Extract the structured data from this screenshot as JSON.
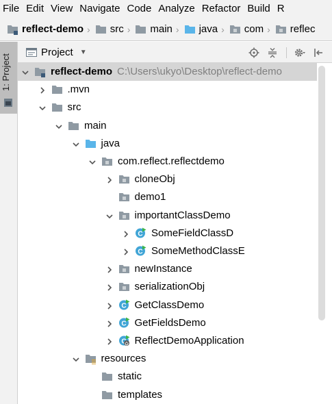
{
  "menu": {
    "items": [
      "File",
      "Edit",
      "View",
      "Navigate",
      "Code",
      "Analyze",
      "Refactor",
      "Build",
      "R"
    ]
  },
  "breadcrumb": {
    "items": [
      {
        "label": "reflect-demo",
        "icon": "module-folder-icon",
        "bold": true
      },
      {
        "label": "src",
        "icon": "folder-icon"
      },
      {
        "label": "main",
        "icon": "folder-icon"
      },
      {
        "label": "java",
        "icon": "source-folder-icon"
      },
      {
        "label": "com",
        "icon": "package-icon"
      },
      {
        "label": "reflec",
        "icon": "package-icon"
      }
    ]
  },
  "tool_window": {
    "tab_label": "1: Project"
  },
  "panel": {
    "title": "Project",
    "header_icons": [
      "locate-icon",
      "collapse-all-icon",
      "settings-gear-icon",
      "hide-panel-icon"
    ]
  },
  "tree": {
    "rows": [
      {
        "label": "reflect-demo",
        "hint": "C:\\Users\\ukyo\\Desktop\\reflect-demo",
        "depth": 0,
        "arrow": "expanded",
        "icon": "module-folder",
        "bold": true,
        "selected": true
      },
      {
        "label": ".mvn",
        "depth": 1,
        "arrow": "collapsed",
        "icon": "folder"
      },
      {
        "label": "src",
        "depth": 1,
        "arrow": "expanded",
        "icon": "folder"
      },
      {
        "label": "main",
        "depth": 2,
        "arrow": "expanded",
        "icon": "folder"
      },
      {
        "label": "java",
        "depth": 3,
        "arrow": "expanded",
        "icon": "source-folder"
      },
      {
        "label": "com.reflect.reflectdemo",
        "depth": 4,
        "arrow": "expanded",
        "icon": "package"
      },
      {
        "label": "cloneObj",
        "depth": 5,
        "arrow": "collapsed",
        "icon": "package"
      },
      {
        "label": "demo1",
        "depth": 5,
        "arrow": "none",
        "icon": "package"
      },
      {
        "label": "importantClassDemo",
        "depth": 5,
        "arrow": "expanded",
        "icon": "package"
      },
      {
        "label": "SomeFieldClassD",
        "depth": 6,
        "arrow": "collapsed",
        "icon": "runnable-class"
      },
      {
        "label": "SomeMethodClassE",
        "depth": 6,
        "arrow": "collapsed",
        "icon": "runnable-class"
      },
      {
        "label": "newInstance",
        "depth": 5,
        "arrow": "collapsed",
        "icon": "package"
      },
      {
        "label": "serializationObj",
        "depth": 5,
        "arrow": "collapsed",
        "icon": "package"
      },
      {
        "label": "GetClassDemo",
        "depth": 5,
        "arrow": "collapsed",
        "icon": "runnable-class"
      },
      {
        "label": "GetFieldsDemo",
        "depth": 5,
        "arrow": "collapsed",
        "icon": "runnable-class"
      },
      {
        "label": "ReflectDemoApplication",
        "depth": 5,
        "arrow": "collapsed",
        "icon": "spring-boot-class"
      },
      {
        "label": "resources",
        "depth": 3,
        "arrow": "expanded",
        "icon": "resources-folder"
      },
      {
        "label": "static",
        "depth": 4,
        "arrow": "none",
        "icon": "folder"
      },
      {
        "label": "templates",
        "depth": 4,
        "arrow": "none",
        "icon": "folder"
      }
    ]
  },
  "colors": {
    "chrome": "#f2f2f2",
    "selection": "#d5d5d5",
    "folder": "#8f9aa3",
    "source_folder": "#5ab5e9",
    "class_badge": "#41a5d6",
    "run_arrow": "#3cb54a",
    "path_hint": "#808080"
  }
}
